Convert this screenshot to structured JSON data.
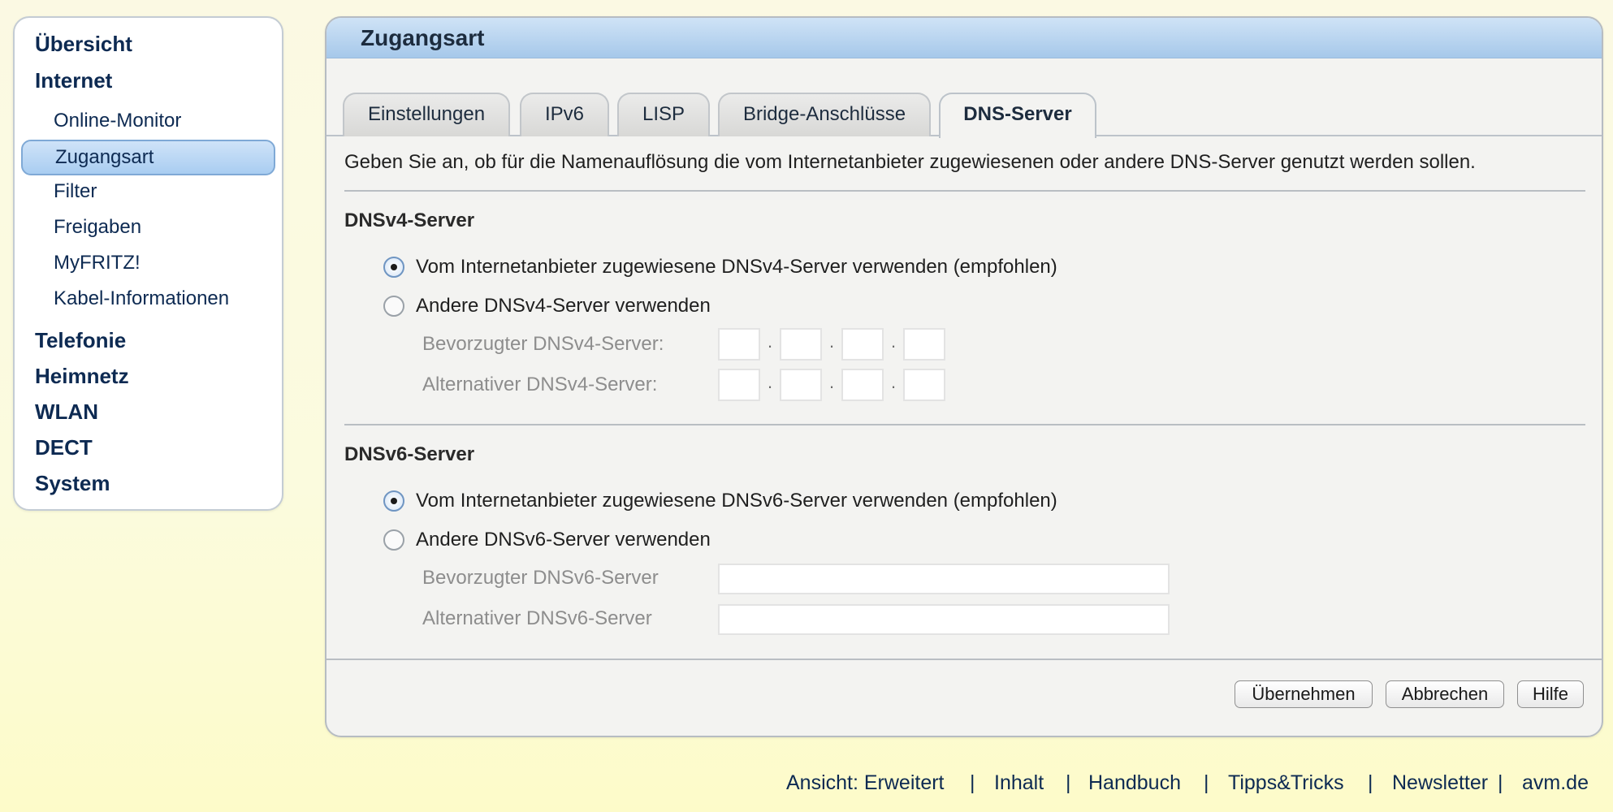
{
  "sidebar": {
    "items": [
      {
        "label": "Übersicht"
      },
      {
        "label": "Internet"
      },
      {
        "label": "Online-Monitor"
      },
      {
        "label": "Zugangsart"
      },
      {
        "label": "Filter"
      },
      {
        "label": "Freigaben"
      },
      {
        "label": "MyFRITZ!"
      },
      {
        "label": "Kabel-Informationen"
      },
      {
        "label": "Telefonie"
      },
      {
        "label": "Heimnetz"
      },
      {
        "label": "WLAN"
      },
      {
        "label": "DECT"
      },
      {
        "label": "System"
      }
    ]
  },
  "panel": {
    "title": "Zugangsart",
    "tabs": [
      {
        "label": "Einstellungen"
      },
      {
        "label": "IPv6"
      },
      {
        "label": "LISP"
      },
      {
        "label": "Bridge-Anschlüsse"
      },
      {
        "label": "DNS-Server"
      }
    ],
    "active_tab": "DNS-Server",
    "intro": "Geben Sie an, ob für die Namenauflösung die vom Internetanbieter zugewiesenen oder andere DNS-Server genutzt werden sollen."
  },
  "dnsv4": {
    "title": "DNSv4-Server",
    "option_isp": "Vom Internetanbieter zugewiesene DNSv4-Server verwenden (empfohlen)",
    "option_other": "Andere DNSv4-Server verwenden",
    "selected": "isp",
    "preferred_label": "Bevorzugter DNSv4-Server:",
    "alternative_label": "Alternativer DNSv4-Server:",
    "preferred_octets": [
      "",
      "",
      "",
      ""
    ],
    "alternative_octets": [
      "",
      "",
      "",
      ""
    ]
  },
  "dnsv6": {
    "title": "DNSv6-Server",
    "option_isp": "Vom Internetanbieter zugewiesene DNSv6-Server verwenden (empfohlen)",
    "option_other": "Andere DNSv6-Server verwenden",
    "selected": "isp",
    "preferred_label": "Bevorzugter DNSv6-Server",
    "alternative_label": "Alternativer DNSv6-Server",
    "preferred_value": "",
    "alternative_value": ""
  },
  "buttons": {
    "apply": "Übernehmen",
    "cancel": "Abbrechen",
    "help": "Hilfe"
  },
  "footer": {
    "links": [
      {
        "label": "Ansicht: Erweitert"
      },
      {
        "label": "Inhalt"
      },
      {
        "label": "Handbuch"
      },
      {
        "label": "Tipps&Tricks"
      },
      {
        "label": "Newsletter"
      },
      {
        "label": "avm.de"
      }
    ],
    "separator": "|"
  },
  "colors": {
    "nav_text": "#0d2a52",
    "header_gradient_top": "#cfe3f6",
    "header_gradient_bottom": "#a6c8ea",
    "active_nav_bg": "#a9cdf1",
    "page_background": "#fbf9e3"
  }
}
